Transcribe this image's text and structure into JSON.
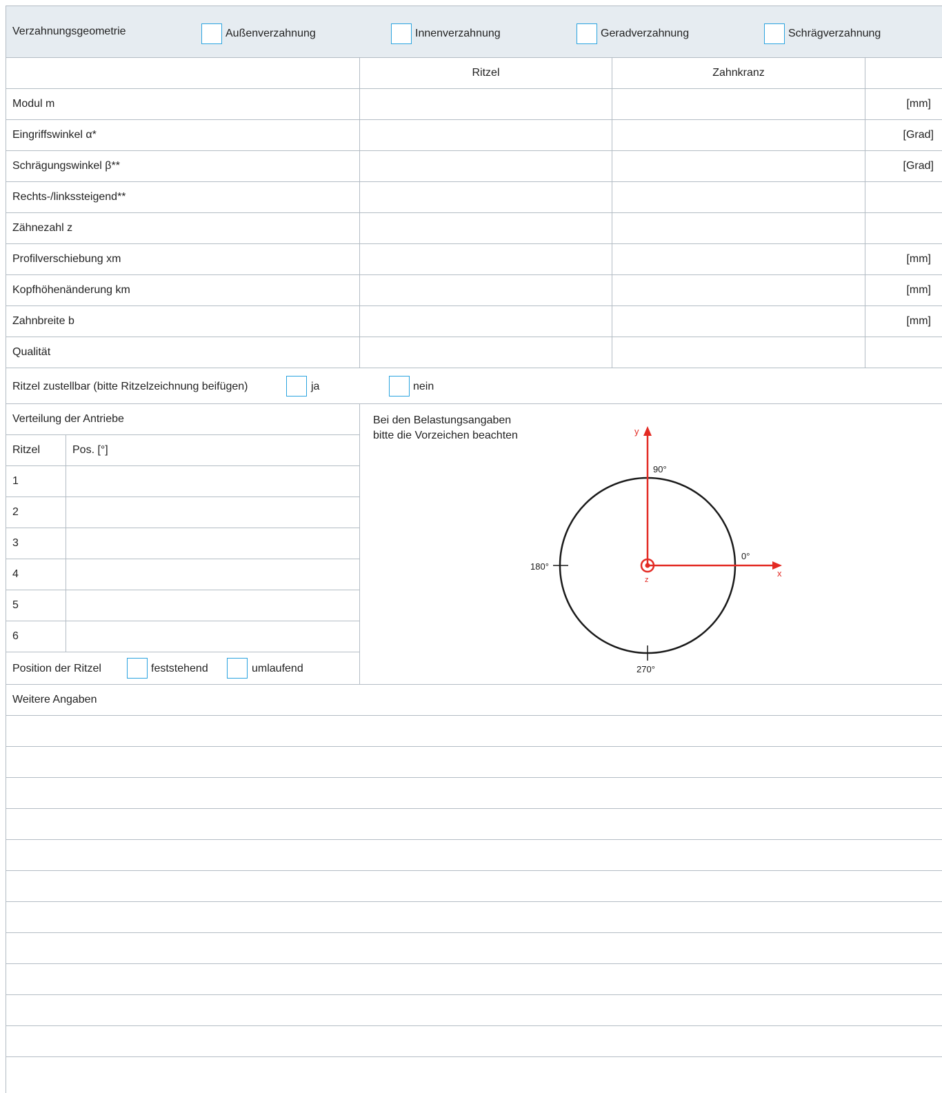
{
  "header": {
    "title": "Verzahnungsgeometrie",
    "options": [
      {
        "label": "Außenverzahnung"
      },
      {
        "label": "Innenverzahnung"
      },
      {
        "label": "Geradverzahnung"
      },
      {
        "label": "Schrägverzahnung"
      }
    ]
  },
  "columns": {
    "ritzel": "Ritzel",
    "zahnkranz": "Zahnkranz"
  },
  "rows": [
    {
      "label": "Modul m",
      "unit": "[mm]"
    },
    {
      "label": "Eingriffswinkel α*",
      "unit": "[Grad]"
    },
    {
      "label": "Schrägungswinkel β**",
      "unit": "[Grad]"
    },
    {
      "label": "Rechts-/linkssteigend**",
      "unit": ""
    },
    {
      "label": "Zähnezahl z",
      "unit": ""
    },
    {
      "label": "Profilverschiebung xm",
      "unit": "[mm]"
    },
    {
      "label": "Kopfhöhenänderung km",
      "unit": "[mm]"
    },
    {
      "label": "Zahnbreite b",
      "unit": "[mm]"
    },
    {
      "label": "Qualität",
      "unit": ""
    }
  ],
  "zustellbar": {
    "label": "Ritzel zustellbar (bitte Ritzelzeichnung beifügen)",
    "yes": "ja",
    "no": "nein"
  },
  "verteilung": {
    "title": "Verteilung der Antriebe",
    "col_ritzel": "Ritzel",
    "col_pos": "Pos. [°]",
    "items": [
      "1",
      "2",
      "3",
      "4",
      "5",
      "6"
    ],
    "position_label": "Position der Ritzel",
    "opt_fixed": "feststehend",
    "opt_rotating": "umlaufend"
  },
  "belastung": {
    "note_line1": "Bei den Belastungsangaben",
    "note_line2": "bitte die Vorzeichen beachten",
    "angle_90": "90°",
    "angle_0": "0°",
    "angle_180": "180°",
    "angle_270": "270°",
    "axis_x": "x",
    "axis_y": "y",
    "axis_z": "z",
    "colors": {
      "axis": "#e32b24",
      "circle": "#1a1a1a"
    }
  },
  "weitere": {
    "title": "Weitere Angaben"
  }
}
